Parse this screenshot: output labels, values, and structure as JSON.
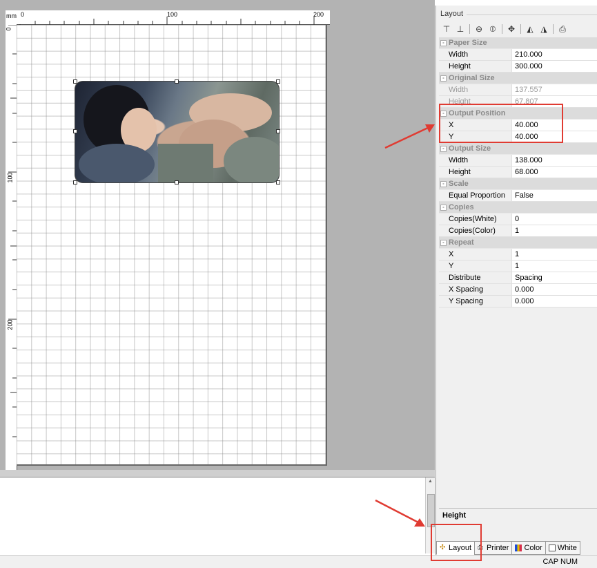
{
  "ruler": {
    "unit": "mm",
    "ticks_h": [
      "0",
      "100",
      "200"
    ],
    "ticks_v": [
      "0",
      "100",
      "200"
    ]
  },
  "panel": {
    "title": "Layout",
    "categories": [
      {
        "name": "Paper Size",
        "rows": [
          {
            "key": "Width",
            "value": "210.000"
          },
          {
            "key": "Height",
            "value": "300.000"
          }
        ]
      },
      {
        "name": "Original Size",
        "rows": [
          {
            "key": "Width",
            "value": "137.557"
          },
          {
            "key": "Height",
            "value": "67.807"
          }
        ]
      },
      {
        "name": "Output Position",
        "rows": [
          {
            "key": "X",
            "value": "40.000"
          },
          {
            "key": "Y",
            "value": "40.000"
          }
        ]
      },
      {
        "name": "Output Size",
        "rows": [
          {
            "key": "Width",
            "value": "138.000"
          },
          {
            "key": "Height",
            "value": "68.000"
          }
        ]
      },
      {
        "name": "Scale",
        "rows": [
          {
            "key": "Equal Proportion",
            "value": "False"
          }
        ]
      },
      {
        "name": "Copies",
        "rows": [
          {
            "key": "Copies(White)",
            "value": "0"
          },
          {
            "key": "Copies(Color)",
            "value": "1"
          }
        ]
      },
      {
        "name": "Repeat",
        "rows": [
          {
            "key": "X",
            "value": "1"
          },
          {
            "key": "Y",
            "value": "1"
          },
          {
            "key": "Distribute",
            "value": "Spacing"
          },
          {
            "key": "X Spacing",
            "value": "0.000"
          },
          {
            "key": "Y Spacing",
            "value": "0.000"
          }
        ]
      }
    ],
    "description_title": "Height"
  },
  "tabs": [
    {
      "label": "Layout"
    },
    {
      "label": "Printer"
    },
    {
      "label": "Color"
    },
    {
      "label": "White"
    }
  ],
  "status": {
    "text": "CAP  NUM"
  },
  "colors": {
    "annotation": "#e03b32",
    "canvas_bg": "#b3b3b3"
  }
}
